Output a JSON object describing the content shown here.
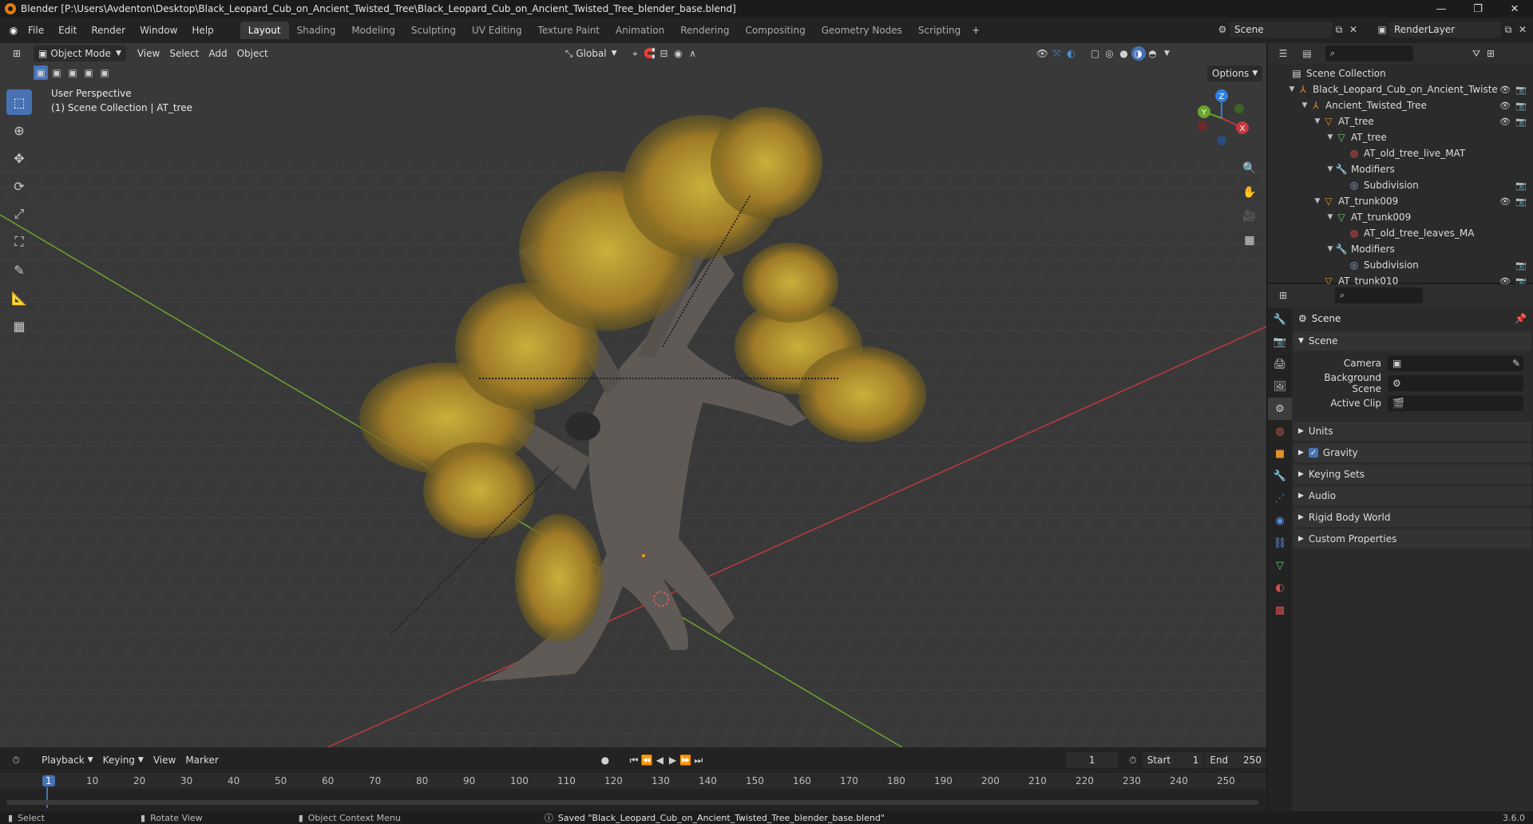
{
  "title": "Blender [P:\\Users\\Avdenton\\Desktop\\Black_Leopard_Cub_on_Ancient_Twisted_Tree\\Black_Leopard_Cub_on_Ancient_Twisted_Tree_blender_base.blend]",
  "menu": [
    "File",
    "Edit",
    "Render",
    "Window",
    "Help"
  ],
  "workspaces": [
    "Layout",
    "Shading",
    "Modeling",
    "Sculpting",
    "UV Editing",
    "Texture Paint",
    "Animation",
    "Rendering",
    "Compositing",
    "Geometry Nodes",
    "Scripting"
  ],
  "active_workspace": "Layout",
  "scene_field": "Scene",
  "renderlayer_field": "RenderLayer",
  "viewport": {
    "mode": "Object Mode",
    "menus": [
      "View",
      "Select",
      "Add",
      "Object"
    ],
    "transform_orientation": "Global",
    "options": "Options",
    "info_line1": "User Perspective",
    "info_line2": "(1) Scene Collection | AT_tree"
  },
  "gizmo": {
    "x": "X",
    "y": "Y",
    "z": "Z"
  },
  "outliner": {
    "rows": [
      {
        "label": "Scene Collection",
        "icon": "collection-icon"
      },
      {
        "label": "Black_Leopard_Cub_on_Ancient_Twiste",
        "icon": "empty-icon"
      },
      {
        "label": "Ancient_Twisted_Tree",
        "icon": "empty-icon"
      },
      {
        "label": "AT_tree",
        "icon": "mesh-object-icon"
      },
      {
        "label": "AT_tree",
        "icon": "mesh-data-icon"
      },
      {
        "label": "AT_old_tree_live_MAT",
        "icon": "material-icon"
      },
      {
        "label": "Modifiers",
        "icon": "wrench-icon"
      },
      {
        "label": "Subdivision",
        "icon": "subdivision-icon"
      },
      {
        "label": "AT_trunk009",
        "icon": "mesh-object-icon"
      },
      {
        "label": "AT_trunk009",
        "icon": "mesh-data-icon"
      },
      {
        "label": "AT_old_tree_leaves_MA",
        "icon": "material-icon"
      },
      {
        "label": "Modifiers",
        "icon": "wrench-icon"
      },
      {
        "label": "Subdivision",
        "icon": "subdivision-icon"
      },
      {
        "label": "AT_trunk010",
        "icon": "mesh-object-icon"
      }
    ]
  },
  "properties": {
    "header": "Scene",
    "panel_scene": "Scene",
    "camera_label": "Camera",
    "bg_scene_label": "Background Scene",
    "active_clip_label": "Active Clip",
    "panels": [
      "Units",
      "Gravity",
      "Keying Sets",
      "Audio",
      "Rigid Body World",
      "Custom Properties"
    ],
    "gravity_checked": true
  },
  "timeline": {
    "menus": [
      "Playback",
      "Keying",
      "View",
      "Marker"
    ],
    "current_frame": "1",
    "start_label": "Start",
    "start": "1",
    "end_label": "End",
    "end": "250",
    "ruler": [
      "1",
      "10",
      "20",
      "30",
      "40",
      "50",
      "60",
      "70",
      "80",
      "90",
      "100",
      "110",
      "120",
      "130",
      "140",
      "150",
      "160",
      "170",
      "180",
      "190",
      "200",
      "210",
      "220",
      "230",
      "240",
      "250"
    ]
  },
  "status": {
    "select": "Select",
    "rotate": "Rotate View",
    "context": "Object Context Menu",
    "message": "Saved \"Black_Leopard_Cub_on_Ancient_Twisted_Tree_blender_base.blend\"",
    "version": "3.6.0"
  },
  "colors": {
    "accent": "#4772b3",
    "x_axis": "#c2393f",
    "y_axis": "#6aa52c",
    "z_axis": "#2f7ee0",
    "leaf": "#b8a233",
    "bark": "#5a5550"
  }
}
